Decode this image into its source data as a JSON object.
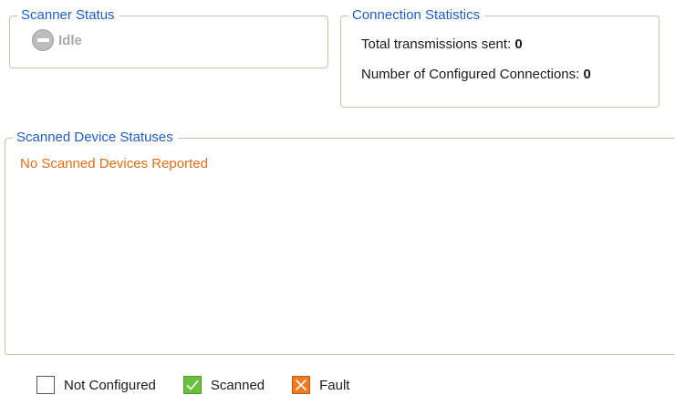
{
  "scanner_status": {
    "title": "Scanner Status",
    "icon": "minus-circle-icon",
    "state": "Idle"
  },
  "connection_statistics": {
    "title": "Connection Statistics",
    "transmissions_label": "Total transmissions sent:",
    "transmissions_value": "0",
    "connections_label": "Number of Configured Connections:",
    "connections_value": "0"
  },
  "scanned_devices": {
    "title": "Scanned Device Statuses",
    "empty_message": "No Scanned Devices Reported"
  },
  "status_legend": {
    "items": [
      {
        "label": "Not Configured",
        "icon": "empty-box-icon",
        "color": "#ffffff"
      },
      {
        "label": "Scanned",
        "icon": "checkmark-icon",
        "color": "#6cbf3d"
      },
      {
        "label": "Fault",
        "icon": "x-mark-icon",
        "color": "#ef7a22"
      }
    ]
  },
  "colors": {
    "legend_title": "#1f5ec8",
    "empty_message": "#e06c16",
    "frame_border": "#c8c2ad",
    "idle_text": "#a8a8a8"
  }
}
